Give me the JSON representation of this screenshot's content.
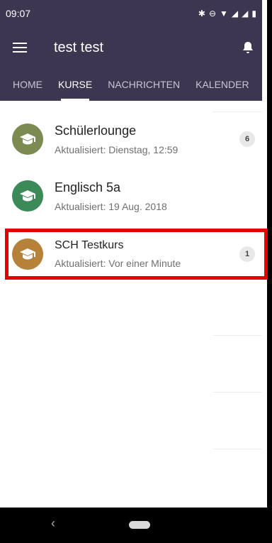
{
  "status": {
    "time": "09:07",
    "icons": [
      "bluetooth-icon",
      "dnd-icon",
      "data-icon",
      "wifi-icon",
      "signal-icon",
      "signal-icon",
      "battery-icon"
    ]
  },
  "app": {
    "title": "test test"
  },
  "tabs": [
    {
      "label": "HOME",
      "active": false
    },
    {
      "label": "KURSE",
      "active": true
    },
    {
      "label": "NACHRICHTEN",
      "active": false
    },
    {
      "label": "KALENDER",
      "active": false
    }
  ],
  "courses": [
    {
      "name": "Schülerlounge",
      "updated": "Aktualisiert: Dienstag, 12:59",
      "badge": "6",
      "color": "#7b8b52"
    },
    {
      "name": " Englisch 5a",
      "updated": "Aktualisiert: 19 Aug. 2018",
      "badge": "",
      "color": "#3b8a57"
    },
    {
      "name": "SCH Testkurs",
      "updated": "Aktualisiert: Vor einer Minute",
      "badge": "1",
      "color": "#b6823a"
    }
  ],
  "colors": {
    "appbar": "#3c3650",
    "highlight": "#e30000"
  }
}
